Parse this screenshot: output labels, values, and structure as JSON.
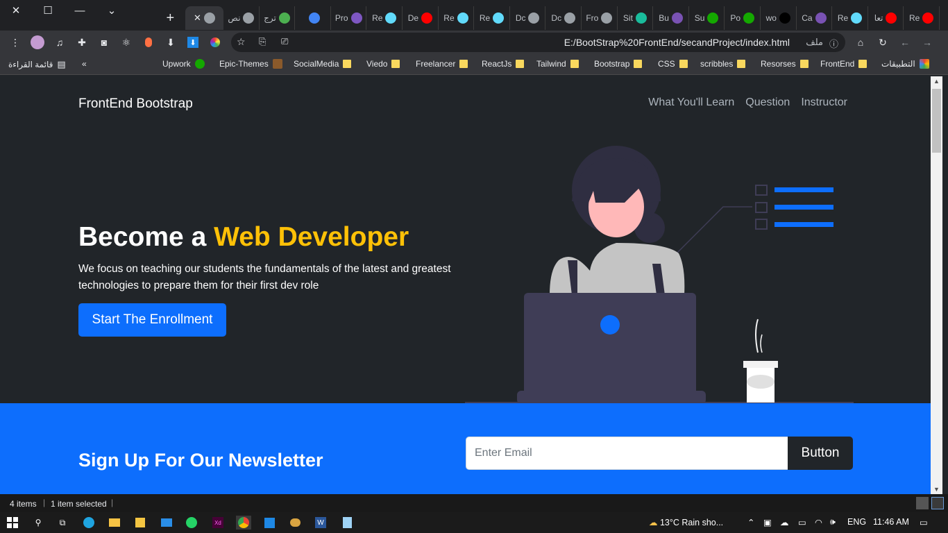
{
  "browser": {
    "tabs": [
      {
        "label": "نص",
        "icon": "globe-icon",
        "color": "#9aa0a6"
      },
      {
        "label": "ترج",
        "icon": "photo-icon",
        "color": "#4caf50"
      },
      {
        "label": "",
        "icon": "translate-icon",
        "color": "#4285f4"
      },
      {
        "label": "Pro",
        "icon": "s-icon",
        "color": "#7e57c2"
      },
      {
        "label": "Re",
        "icon": "react-icon",
        "color": "#61dafb"
      },
      {
        "label": "De",
        "icon": "youtube-icon",
        "color": "#ff0000"
      },
      {
        "label": "Re",
        "icon": "react-icon",
        "color": "#61dafb"
      },
      {
        "label": "Re",
        "icon": "react-icon",
        "color": "#61dafb"
      },
      {
        "label": "Dc",
        "icon": "globe-icon",
        "color": "#9aa0a6"
      },
      {
        "label": "Dc",
        "icon": "globe-icon",
        "color": "#9aa0a6"
      },
      {
        "label": "Fro",
        "icon": "globe-icon",
        "color": "#9aa0a6"
      },
      {
        "label": "Sit",
        "icon": "diamond-icon",
        "color": "#1abc9c"
      },
      {
        "label": "Bu",
        "icon": "bootstrap-icon",
        "color": "#7952b3"
      },
      {
        "label": "Su",
        "icon": "upwork-icon",
        "color": "#14a800"
      },
      {
        "label": "Po",
        "icon": "upwork-icon",
        "color": "#14a800"
      },
      {
        "label": "wo",
        "icon": "figure-icon",
        "color": "#000000"
      },
      {
        "label": "Ca",
        "icon": "bootstrap-icon",
        "color": "#7952b3"
      },
      {
        "label": "Re",
        "icon": "react-icon",
        "color": "#61dafb"
      },
      {
        "label": "تعا",
        "icon": "youtube-icon",
        "color": "#ff0000"
      },
      {
        "label": "Re",
        "icon": "youtube-icon",
        "color": "#ff0000"
      }
    ],
    "url": "E:/BootStrap%20FrontEnd/secandProject/index.html",
    "url_prefix": "ملف",
    "bookmarks": [
      {
        "label": "Upwork",
        "icon": "upwork-icon"
      },
      {
        "label": "Epic-Themes",
        "icon": "epic-icon"
      },
      {
        "label": "SocialMedia",
        "icon": "folder-icon"
      },
      {
        "label": "Viedo",
        "icon": "folder-icon"
      },
      {
        "label": "Freelancer",
        "icon": "folder-icon"
      },
      {
        "label": "ReactJs",
        "icon": "folder-icon"
      },
      {
        "label": "Tailwind",
        "icon": "folder-icon"
      },
      {
        "label": "Bootstrap",
        "icon": "folder-icon"
      },
      {
        "label": "CSS",
        "icon": "folder-icon"
      },
      {
        "label": "scribbles",
        "icon": "folder-icon"
      },
      {
        "label": "Resorses",
        "icon": "folder-icon"
      },
      {
        "label": "FrontEnd",
        "icon": "folder-icon"
      },
      {
        "label": "التطبيقات",
        "icon": "apps-icon"
      }
    ],
    "reading_list": "قائمة القراءة"
  },
  "page": {
    "brand": "FrontEnd Bootstrap",
    "nav": [
      "What You'll Learn",
      "Question",
      "Instructor"
    ],
    "hero": {
      "title_prefix": "Become a ",
      "title_highlight": "Web Developer",
      "text": "We focus on teaching our students the fundamentals of the latest and greatest technologies to prepare them for their first dev role",
      "button": "Start The Enrollment"
    },
    "newsletter": {
      "title": "Sign Up For Our Newsletter",
      "placeholder": "Enter Email",
      "button": "Button"
    }
  },
  "explorer": {
    "items": "4 items",
    "selected": "1 item selected"
  },
  "taskbar": {
    "weather": "13°C  Rain sho...",
    "lang": "ENG",
    "time": "11:46 AM"
  },
  "colors": {
    "accent": "#0d6efd",
    "highlight": "#ffc107",
    "dark": "#212529"
  }
}
